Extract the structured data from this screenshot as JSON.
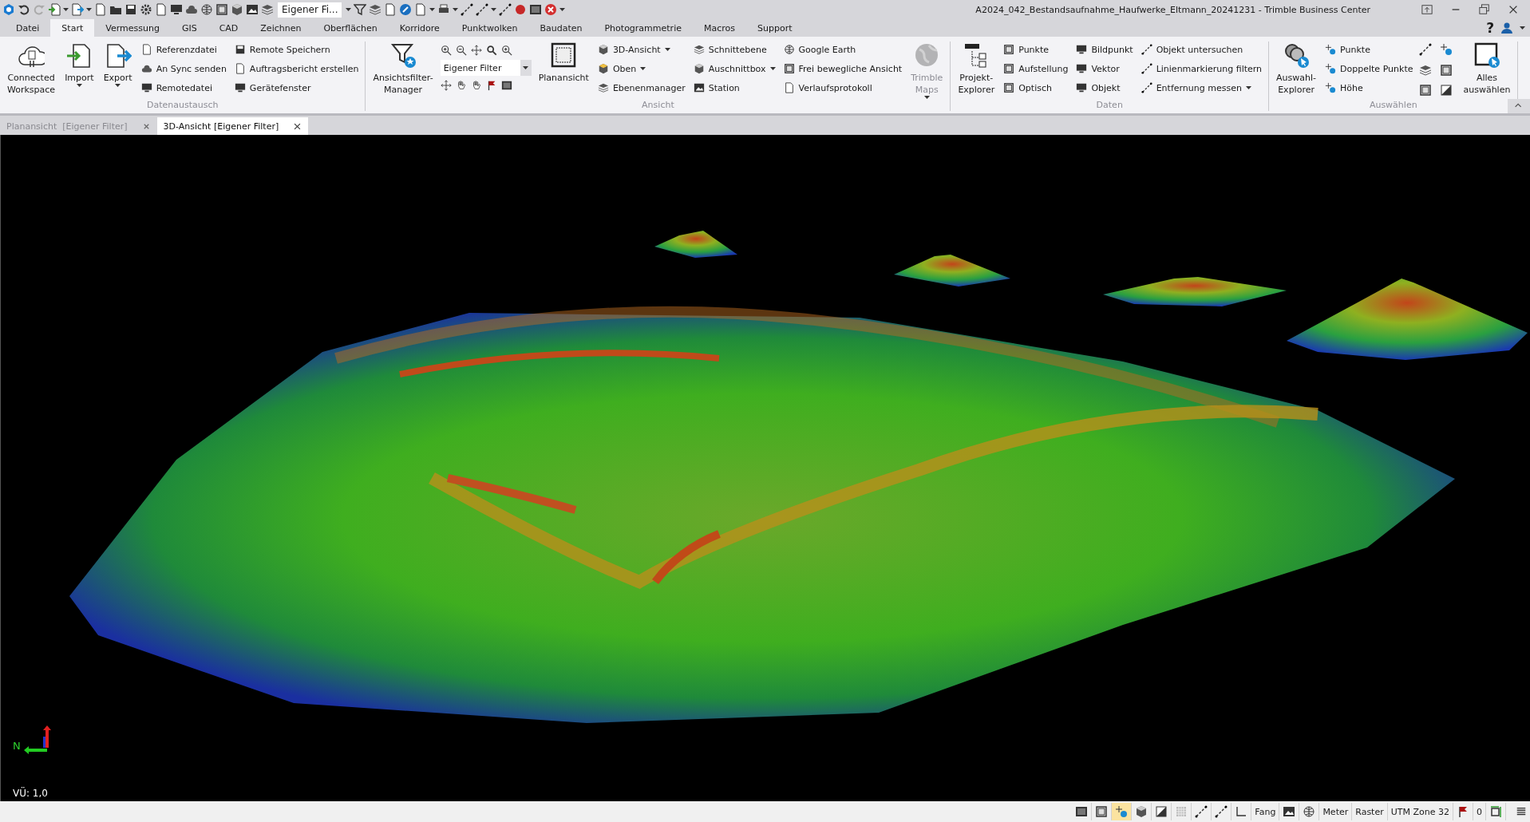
{
  "window": {
    "title": "A2024_042_Bestandsaufnahme_Haufwerke_Eltmann_20241231 - Trimble Business Center"
  },
  "quick_access": {
    "combo_value": "Eigener Fi..."
  },
  "help_label": "?",
  "menu_tabs": [
    {
      "label": "Datei",
      "selected": false
    },
    {
      "label": "Start",
      "selected": true
    },
    {
      "label": "Vermessung",
      "selected": false
    },
    {
      "label": "GIS",
      "selected": false
    },
    {
      "label": "CAD",
      "selected": false
    },
    {
      "label": "Zeichnen",
      "selected": false
    },
    {
      "label": "Oberflächen",
      "selected": false
    },
    {
      "label": "Korridore",
      "selected": false
    },
    {
      "label": "Punktwolken",
      "selected": false
    },
    {
      "label": "Baudaten",
      "selected": false
    },
    {
      "label": "Photogrammetrie",
      "selected": false
    },
    {
      "label": "Macros",
      "selected": false
    },
    {
      "label": "Support",
      "selected": false
    }
  ],
  "ribbon_groups": [
    {
      "label": "Datenaustausch",
      "items": [
        {
          "kind": "large",
          "label": "Connected\nWorkspace",
          "dropdown": false,
          "disabled": false
        },
        {
          "kind": "large",
          "label": "Import",
          "dropdown": true,
          "disabled": false
        },
        {
          "kind": "large",
          "label": "Export",
          "dropdown": true,
          "disabled": false
        },
        {
          "kind": "column",
          "entries": [
            {
              "label": "Referenzdatei",
              "dropdown": false
            },
            {
              "label": "An Sync senden",
              "dropdown": false
            },
            {
              "label": "Remotedatei",
              "dropdown": false
            }
          ]
        },
        {
          "kind": "column",
          "entries": [
            {
              "label": "Remote Speichern",
              "dropdown": false
            },
            {
              "label": "Auftragsbericht erstellen",
              "dropdown": false
            },
            {
              "label": "Gerätefenster",
              "dropdown": false
            }
          ]
        }
      ]
    },
    {
      "label": "Ansicht",
      "items": [
        {
          "kind": "large",
          "label": "Ansichtsfilter-\nManager",
          "dropdown": false,
          "disabled": false
        },
        {
          "kind": "view_tools",
          "filter_value": "Eigener Filter"
        },
        {
          "kind": "large",
          "label": "Planansicht",
          "dropdown": false,
          "disabled": false
        },
        {
          "kind": "column",
          "entries": [
            {
              "label": "3D-Ansicht",
              "dropdown": true
            },
            {
              "label": "Oben",
              "dropdown": true
            },
            {
              "label": "Ebenenmanager",
              "dropdown": false
            }
          ]
        },
        {
          "kind": "column",
          "entries": [
            {
              "label": "Schnittebene",
              "dropdown": false
            },
            {
              "label": "Auschnittbox",
              "dropdown": true
            },
            {
              "label": "Station",
              "dropdown": false
            }
          ]
        },
        {
          "kind": "column",
          "entries": [
            {
              "label": "Google Earth",
              "dropdown": false
            },
            {
              "label": "Frei bewegliche Ansicht",
              "dropdown": false
            },
            {
              "label": "Verlaufsprotokoll",
              "dropdown": false
            }
          ]
        },
        {
          "kind": "large",
          "label": "Trimble\nMaps",
          "dropdown": true,
          "disabled": true
        }
      ]
    },
    {
      "label": "Daten",
      "items": [
        {
          "kind": "large",
          "label": "Projekt-\nExplorer",
          "dropdown": false,
          "disabled": false
        },
        {
          "kind": "column",
          "entries": [
            {
              "label": "Punkte",
              "dropdown": false
            },
            {
              "label": "Aufstellung",
              "dropdown": false
            },
            {
              "label": "Optisch",
              "dropdown": false
            }
          ]
        },
        {
          "kind": "column",
          "entries": [
            {
              "label": "Bildpunkt",
              "dropdown": false
            },
            {
              "label": "Vektor",
              "dropdown": false
            },
            {
              "label": "Objekt",
              "dropdown": false
            }
          ]
        },
        {
          "kind": "column",
          "entries": [
            {
              "label": "Objekt untersuchen",
              "dropdown": false
            },
            {
              "label": "Linienmarkierung filtern",
              "dropdown": false
            },
            {
              "label": "Entfernung messen",
              "dropdown": true
            }
          ]
        }
      ]
    },
    {
      "label": "Auswählen",
      "items": [
        {
          "kind": "large",
          "label": "Auswahl-\nExplorer",
          "dropdown": false,
          "disabled": false
        },
        {
          "kind": "column",
          "entries": [
            {
              "label": "Punkte",
              "dropdown": false
            },
            {
              "label": "Doppelte Punkte",
              "dropdown": false
            },
            {
              "label": "Höhe",
              "dropdown": false
            }
          ]
        },
        {
          "kind": "icon_grid"
        },
        {
          "kind": "large",
          "label": "Alles\nauswählen",
          "dropdown": false,
          "disabled": false
        }
      ]
    }
  ],
  "document_tabs": [
    {
      "label": "Planansicht  [Eigener Filter]",
      "selected": false
    },
    {
      "label": "3D-Ansicht [Eigener Filter]",
      "selected": true
    }
  ],
  "viewport": {
    "axis_label": "N",
    "scale_label": "VÜ: 1,0"
  },
  "status_bar": [
    {
      "kind": "icon",
      "selected": false
    },
    {
      "kind": "icon",
      "selected": false
    },
    {
      "kind": "icon",
      "selected": true
    },
    {
      "kind": "icon",
      "selected": false
    },
    {
      "kind": "icon",
      "selected": false
    },
    {
      "kind": "icon",
      "selected": false
    },
    {
      "kind": "icon",
      "selected": false
    },
    {
      "kind": "icon",
      "selected": false
    },
    {
      "kind": "icon",
      "selected": false
    },
    {
      "kind": "text",
      "text": "Fang"
    },
    {
      "kind": "icon",
      "selected": false
    },
    {
      "kind": "icon",
      "selected": false
    },
    {
      "kind": "text",
      "text": "Meter"
    },
    {
      "kind": "text",
      "text": "Raster"
    },
    {
      "kind": "text",
      "text": "UTM Zone 32"
    },
    {
      "kind": "icon",
      "selected": false
    },
    {
      "kind": "text",
      "text": "0"
    },
    {
      "kind": "icon",
      "selected": false
    }
  ]
}
